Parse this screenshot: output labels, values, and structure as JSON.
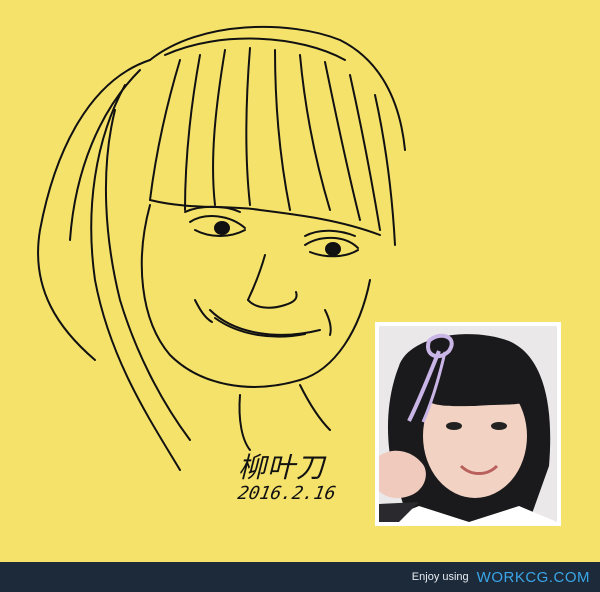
{
  "artwork": {
    "signature": "柳叶刀",
    "date": "2016.2.16",
    "background_color": "#f5e26b"
  },
  "footer": {
    "text": "Enjoy using",
    "brand": "WORKCG.COM",
    "background_color": "#1d2a3a",
    "brand_color": "#3aa6e8"
  }
}
